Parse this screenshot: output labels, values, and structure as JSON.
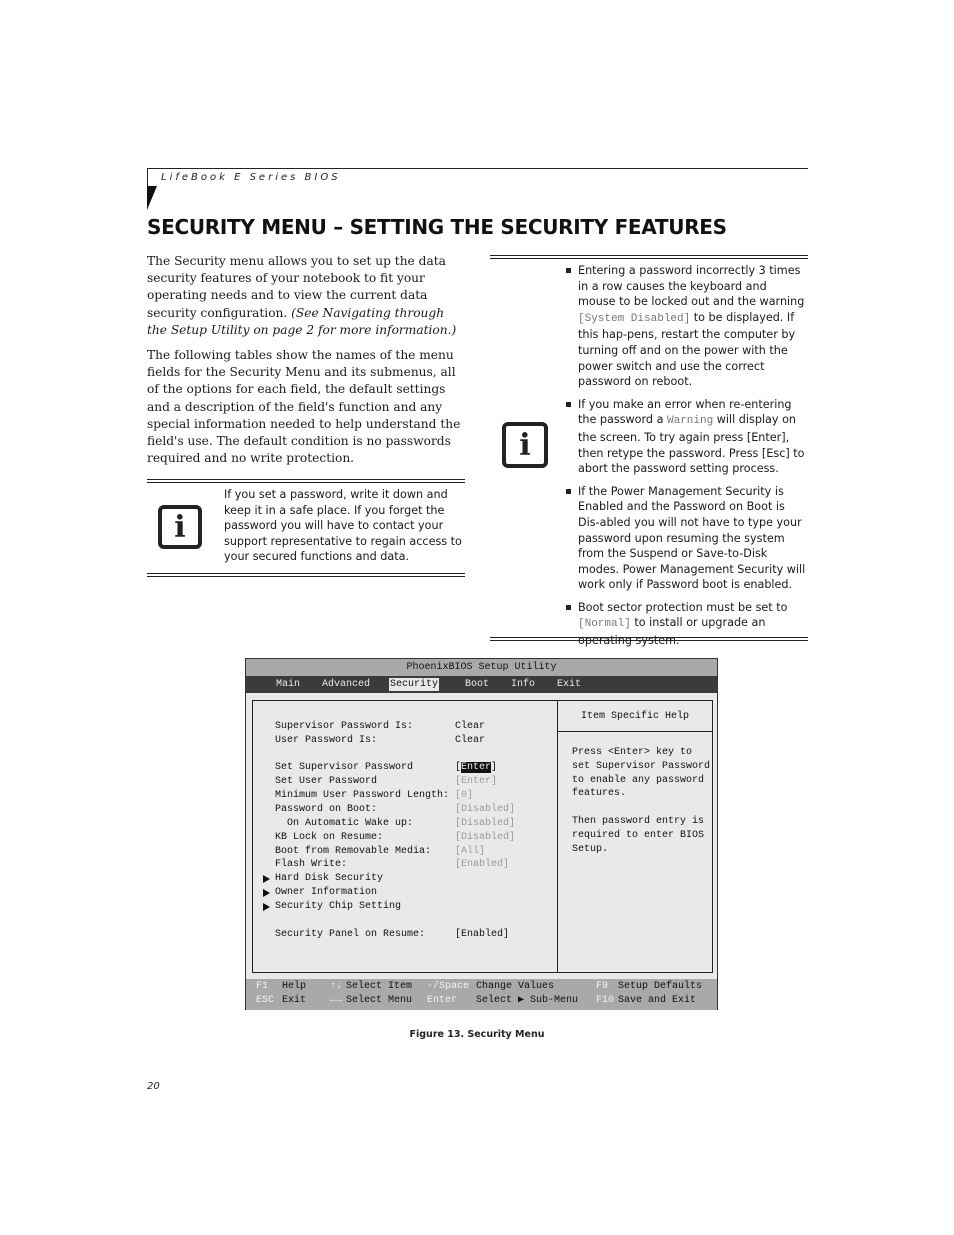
{
  "header": {
    "running_title": "LifeBook E Series BIOS"
  },
  "page": {
    "title": "SECURITY MENU – SETTING THE SECURITY FEATURES",
    "paragraph1_plain": "The Security menu allows you to set up the data security features of your notebook to fit your operating needs and to view the current data security configuration. ",
    "paragraph1_italic": "(See Navigating through the Setup Utility on page 2 for more information.)",
    "paragraph2": "The following tables show the names of the menu fields for the Security Menu and its submenus, all of the options for each field, the default settings and a description of the field's function and any special information needed to help understand the field's use. The default condition is no passwords required and no write protection.",
    "page_number": "20"
  },
  "note_left": {
    "icon": "info-icon",
    "text": "If you set a password, write it down and keep it in a safe place. If you forget the password you will have to contact your support representative to regain access to your secured functions and data."
  },
  "note_right": {
    "icon": "info-icon",
    "bullets": [
      {
        "pre": "Entering a password incorrectly 3 times in a row causes the keyboard and mouse to be locked out and the warning ",
        "code": "[System Disabled]",
        "post": " to be displayed. If this hap-pens, restart the computer by turning off and on the power with the power switch and use the correct password on reboot."
      },
      {
        "pre": "If you make an error when re-entering the password a ",
        "code": "Warning",
        "post": " will display on the screen. To try again press [Enter], then retype the password. Press [Esc] to abort the password setting process."
      },
      {
        "pre": "If the Power Management Security is Enabled and the Password on Boot is Dis-abled you will not have to type your password upon resuming the system from the Suspend or Save-to-Disk modes. Power Management Security will work only if Password boot is enabled.",
        "code": "",
        "post": ""
      },
      {
        "pre": "Boot sector protection must be set to ",
        "code": "[Normal]",
        "post": " to install or upgrade an operating system."
      }
    ]
  },
  "bios": {
    "title": "PhoenixBIOS Setup Utility",
    "menu": [
      "Main",
      "Advanced",
      "Security",
      "Boot",
      "Info",
      "Exit"
    ],
    "active_menu": "Security",
    "rows": [
      {
        "label": "Supervisor Password Is:",
        "value": "Clear",
        "state": "normal"
      },
      {
        "label": "User Password Is:",
        "value": "Clear",
        "state": "normal"
      },
      {
        "label": "Set Supervisor Password",
        "value_prefix": "[",
        "value_selected": "Enter",
        "value_suffix": "]",
        "state": "selected"
      },
      {
        "label": "Set User Password",
        "value": "[Enter]",
        "state": "dim"
      },
      {
        "label": "Minimum User Password Length:",
        "value": "[0]",
        "state": "dim"
      },
      {
        "label": "Password on Boot:",
        "value": "[Disabled]",
        "state": "dim"
      },
      {
        "label": "  On Automatic Wake up:",
        "value": "[Disabled]",
        "state": "dim"
      },
      {
        "label": "KB Lock on Resume:",
        "value": "[Disabled]",
        "state": "dim"
      },
      {
        "label": "Boot from Removable Media:",
        "value": "[All]",
        "state": "dim"
      },
      {
        "label": "Flash Write:",
        "value": "[Enabled]",
        "state": "dim"
      },
      {
        "label": "Hard Disk Security",
        "submenu": true
      },
      {
        "label": "Owner Information",
        "submenu": true
      },
      {
        "label": "Security Chip Setting",
        "submenu": true
      },
      {
        "label": "Security Panel on Resume:",
        "value": "[Enabled]",
        "state": "normal"
      }
    ],
    "help": {
      "heading": "Item Specific Help",
      "body": "Press <Enter> key to\nset Supervisor Password\nto enable any password\nfeatures.\n\nThen password entry is\nrequired to enter BIOS\nSetup."
    },
    "footer": {
      "row1": [
        {
          "key": "F1",
          "action": "Help"
        },
        {
          "key": "↑↓",
          "action": "Select Item"
        },
        {
          "key": "-/Space",
          "action": "Change Values"
        },
        {
          "key": "F9",
          "action": "Setup Defaults"
        }
      ],
      "row2": [
        {
          "key": "ESC",
          "action": "Exit"
        },
        {
          "key": "←→",
          "action": "Select Menu"
        },
        {
          "key": "Enter",
          "action": "Select ▶ Sub-Menu"
        },
        {
          "key": "F10",
          "action": "Save and Exit"
        }
      ]
    }
  },
  "caption": "Figure 13.  Security Menu"
}
